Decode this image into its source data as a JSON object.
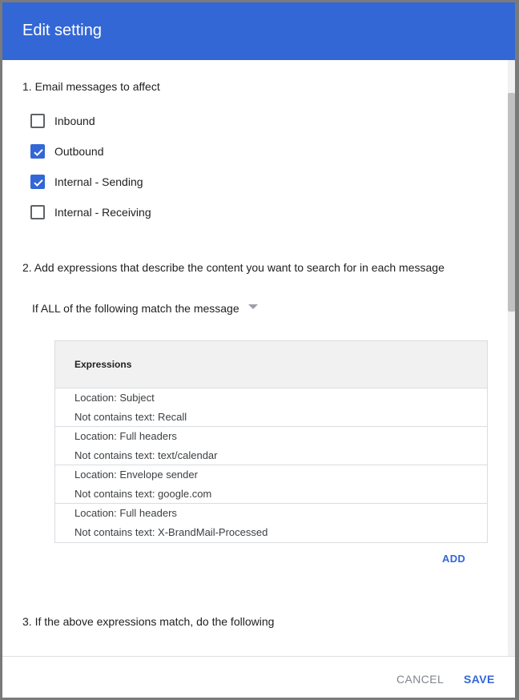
{
  "dialog": {
    "title": "Edit setting",
    "header_color": "#3367d6"
  },
  "section1": {
    "label": "1. Email messages to affect",
    "options": [
      {
        "label": "Inbound",
        "checked": false
      },
      {
        "label": "Outbound",
        "checked": true
      },
      {
        "label": "Internal - Sending",
        "checked": true
      },
      {
        "label": "Internal - Receiving",
        "checked": false
      }
    ]
  },
  "section2": {
    "label": "2. Add expressions that describe the content you want to search for in each message",
    "match_select": "If ALL of the following match the message",
    "table_header": "Expressions",
    "expressions": [
      {
        "location": "Location: Subject",
        "condition": "Not contains text: Recall"
      },
      {
        "location": "Location: Full headers",
        "condition": "Not contains text: text/calendar"
      },
      {
        "location": "Location: Envelope sender",
        "condition": "Not contains text: google.com"
      },
      {
        "location": "Location: Full headers",
        "condition": "Not contains text: X-BrandMail-Processed"
      }
    ],
    "add_label": "ADD"
  },
  "section3": {
    "label": "3. If the above expressions match, do the following"
  },
  "footer": {
    "cancel_label": "CANCEL",
    "save_label": "SAVE"
  }
}
